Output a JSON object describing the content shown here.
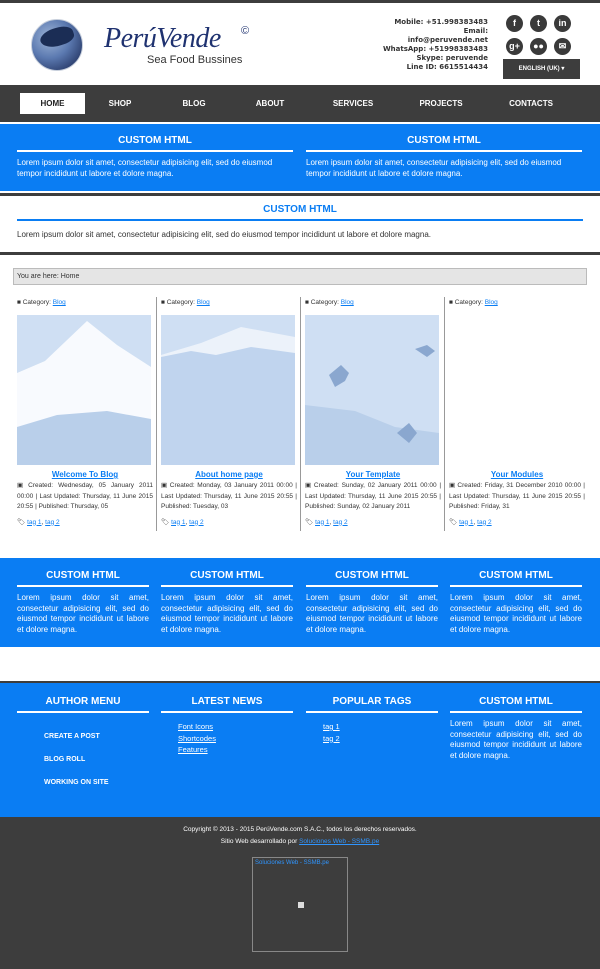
{
  "brand": {
    "name": "PerúVende",
    "copyright_mark": "©",
    "tagline": "Sea Food Bussines"
  },
  "contact": [
    "Mobile: +51.998383483",
    "Email:",
    "info@peruvende.net",
    "WhatsApp: +51998383483",
    "Skype: peruvende",
    "Line ID: 6615514434"
  ],
  "social_icons": [
    "facebook-icon",
    "tumblr-icon",
    "linkedin-icon",
    "google-plus-icon",
    "flickr-icon",
    "mail-icon"
  ],
  "language": "ENGLISH (UK) ▾",
  "nav": [
    "HOME",
    "SHOP",
    "BLOG",
    "ABOUT",
    "SERVICES",
    "PROJECTS",
    "CONTACTS"
  ],
  "custom_html": {
    "title": "CUSTOM HTML",
    "text": "Lorem ipsum dolor sit amet, consectetur adipisicing elit, sed do eiusmod tempor incididunt ut labore et dolore magna."
  },
  "breadcrumb": "You are here: Home",
  "articles": [
    {
      "category_label": "Category:",
      "category": "Blog",
      "title": "Welcome To Blog",
      "meta": "Created: Wednesday, 05 January 2011 00:00 | Last Updated: Thursday, 11 June 2015 20:55 | Published: Thursday, 05",
      "tags": [
        "tag 1",
        "tag 2"
      ]
    },
    {
      "category_label": "Category:",
      "category": "Blog",
      "title": "About home page",
      "meta": "Created: Monday, 03 January 2011 00:00 | Last Updated: Thursday, 11 June 2015 20:55 | Published: Tuesday, 03",
      "tags": [
        "tag 1",
        "tag 2"
      ]
    },
    {
      "category_label": "Category:",
      "category": "Blog",
      "title": "Your Template",
      "meta": "Created: Sunday, 02 January 2011 00:00 | Last Updated: Thursday, 11 June 2015 20:55 | Published: Sunday, 02 January 2011",
      "tags": [
        "tag 1",
        "tag 2"
      ]
    },
    {
      "category_label": "Category:",
      "category": "Blog",
      "title": "Your Modules",
      "meta": "Created: Friday, 31 December 2010 00:00 | Last Updated: Thursday, 11 June 2015 20:55 | Published: Friday, 31",
      "tags": [
        "tag 1",
        "tag 2"
      ]
    }
  ],
  "footer": {
    "author_menu": {
      "title": "AUTHOR MENU",
      "items": [
        "CREATE A POST",
        "BLOG ROLL",
        "WORKING ON SITE"
      ]
    },
    "latest_news": {
      "title": "LATEST NEWS",
      "items": [
        "Font Icons",
        "Shortcodes",
        "Features"
      ]
    },
    "popular_tags": {
      "title": "POPULAR TAGS",
      "items": [
        "tag 1",
        "tag 2"
      ]
    },
    "custom": {
      "title": "CUSTOM HTML",
      "text": "Lorem ipsum dolor sit amet, consectetur adipisicing elit, sed do eiusmod tempor incididunt ut labore et dolore magna."
    }
  },
  "bottom": {
    "copyright": "Copyright © 2013 - 2015 PerúVende.com S.A.C., todos los derechos reservados.",
    "dev_label": "Sitio Web desarrollado por",
    "dev_link": "Soluciones Web - SSMB.pe",
    "badge_text": "Soluciones Web - SSMB.pe"
  },
  "colors": {
    "accent": "#0a7df3",
    "dark": "#3d3d3d",
    "image": "#cfdff3"
  }
}
